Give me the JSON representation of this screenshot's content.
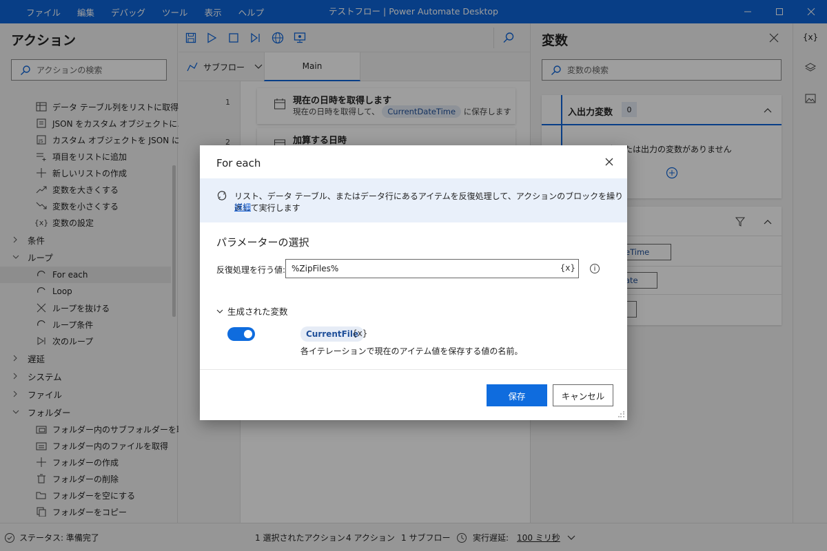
{
  "window": {
    "title": "テストフロー | Power Automate Desktop",
    "menu": [
      "ファイル",
      "編集",
      "デバッグ",
      "ツール",
      "表示",
      "ヘルプ"
    ]
  },
  "actions_panel": {
    "title": "アクション",
    "search_placeholder": "アクションの検索",
    "items_top": [
      {
        "label": "データ テーブル列をリストに取得",
        "icon": "table-icon"
      },
      {
        "label": "JSON をカスタム オブジェクトに...",
        "icon": "json-icon"
      },
      {
        "label": "カスタム オブジェクトを JSON に...",
        "icon": "json-icon"
      },
      {
        "label": "項目をリストに追加",
        "icon": "list-add-icon"
      },
      {
        "label": "新しいリストの作成",
        "icon": "plus-icon"
      },
      {
        "label": "変数を大きくする",
        "icon": "trend-up-icon"
      },
      {
        "label": "変数を小さくする",
        "icon": "trend-down-icon"
      },
      {
        "label": "変数の設定",
        "icon": "variable-icon"
      }
    ],
    "groups": {
      "conditions": "条件",
      "loops": "ループ",
      "wait": "遅延",
      "system": "システム",
      "file": "ファイル",
      "folder": "フォルダー"
    },
    "loop_items": [
      "For each",
      "Loop",
      "ループを抜ける",
      "ループ条件",
      "次のループ"
    ],
    "folder_items": [
      "フォルダー内のサブフォルダーを取得",
      "フォルダー内のファイルを取得",
      "フォルダーの作成",
      "フォルダーの削除",
      "フォルダーを空にする",
      "フォルダーをコピー"
    ]
  },
  "designer": {
    "subflow_label": "サブフロー",
    "main_tab": "Main",
    "steps": [
      {
        "num": "1",
        "title": "現在の日時を取得します",
        "desc_prefix": "現在の日時を取得して、",
        "var": "CurrentDateTime",
        "desc_suffix": "に保存します"
      },
      {
        "num": "2",
        "title": "加算する日時"
      }
    ]
  },
  "variables_panel": {
    "title": "変数",
    "search_placeholder": "変数の検索",
    "io_title": "入出力変数",
    "io_count": "0",
    "io_empty": "まだ入力または出力の変数がありません",
    "flow_vars_partial": [
      "eTime",
      "ate"
    ]
  },
  "status": {
    "state": "ステータス: 準備完了",
    "selected": "1 選択されたアクション",
    "actions": "4 アクション",
    "subflows": "1 サブフロー",
    "delay_label": "実行遅延:",
    "delay_value": "100 ミリ秒"
  },
  "dialog": {
    "title": "For each",
    "info": "リスト、データ テーブル、またはデータ行にあるアイテムを反復処理して、アクションのブロックを繰り返して実行します",
    "info_link": "詳細",
    "section": "パラメーターの選択",
    "param_label": "反復処理を行う値:",
    "param_value": "%ZipFiles%",
    "var_button": "{x}",
    "generated_title": "生成された変数",
    "generated_var": "CurrentFile",
    "generated_toggle_on": true,
    "generated_desc": "各イテレーションで現在のアイテム値を保存する値の名前。",
    "save": "保存",
    "cancel": "キャンセル"
  },
  "colors": {
    "brand": "#0d64d8",
    "primary_button": "#0f6cde",
    "pill_bg": "#e6ecf6",
    "pill_text": "#1f4f99"
  }
}
